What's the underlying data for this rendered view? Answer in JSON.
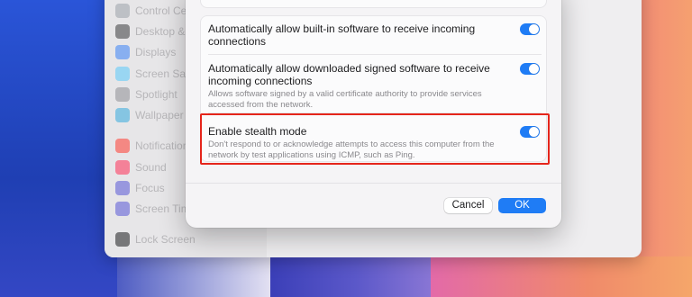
{
  "background_window": {
    "sidebar_items": [
      {
        "label": "Control Centre",
        "icon": "control-centre-icon",
        "color": "#9aa0a8"
      },
      {
        "label": "Desktop & Dock",
        "icon": "desktop-dock-icon",
        "color": "#3a3a3c"
      },
      {
        "label": "Displays",
        "icon": "displays-icon",
        "color": "#3b82f6"
      },
      {
        "label": "Screen Saver",
        "icon": "screen-saver-icon",
        "color": "#5ac8fa"
      },
      {
        "label": "Spotlight",
        "icon": "spotlight-icon",
        "color": "#8e8e93"
      },
      {
        "label": "Wallpaper",
        "icon": "wallpaper-icon",
        "color": "#34aadc"
      },
      {
        "label": "Notifications",
        "icon": "notifications-icon",
        "color": "#ff3b30"
      },
      {
        "label": "Sound",
        "icon": "sound-icon",
        "color": "#ff2d55"
      },
      {
        "label": "Focus",
        "icon": "focus-icon",
        "color": "#5856d6"
      },
      {
        "label": "Screen Time",
        "icon": "screen-time-icon",
        "color": "#5856d6"
      },
      {
        "label": "Lock Screen",
        "icon": "lock-screen-icon",
        "color": "#1c1c1e"
      }
    ]
  },
  "dialog": {
    "options": [
      {
        "title": "Automatically allow built-in software to receive incoming connections",
        "description": "",
        "enabled": true
      },
      {
        "title": "Automatically allow downloaded signed software to receive incoming connections",
        "description": "Allows software signed by a valid certificate authority to provide services accessed from the network.",
        "enabled": true
      },
      {
        "title": "Enable stealth mode",
        "description": "Don't respond to or acknowledge attempts to access this computer from the network by test applications using ICMP, such as Ping.",
        "enabled": true
      }
    ],
    "cancel_label": "Cancel",
    "ok_label": "OK"
  },
  "colors": {
    "accent": "#1f7cf5",
    "highlight": "#e5251b"
  }
}
